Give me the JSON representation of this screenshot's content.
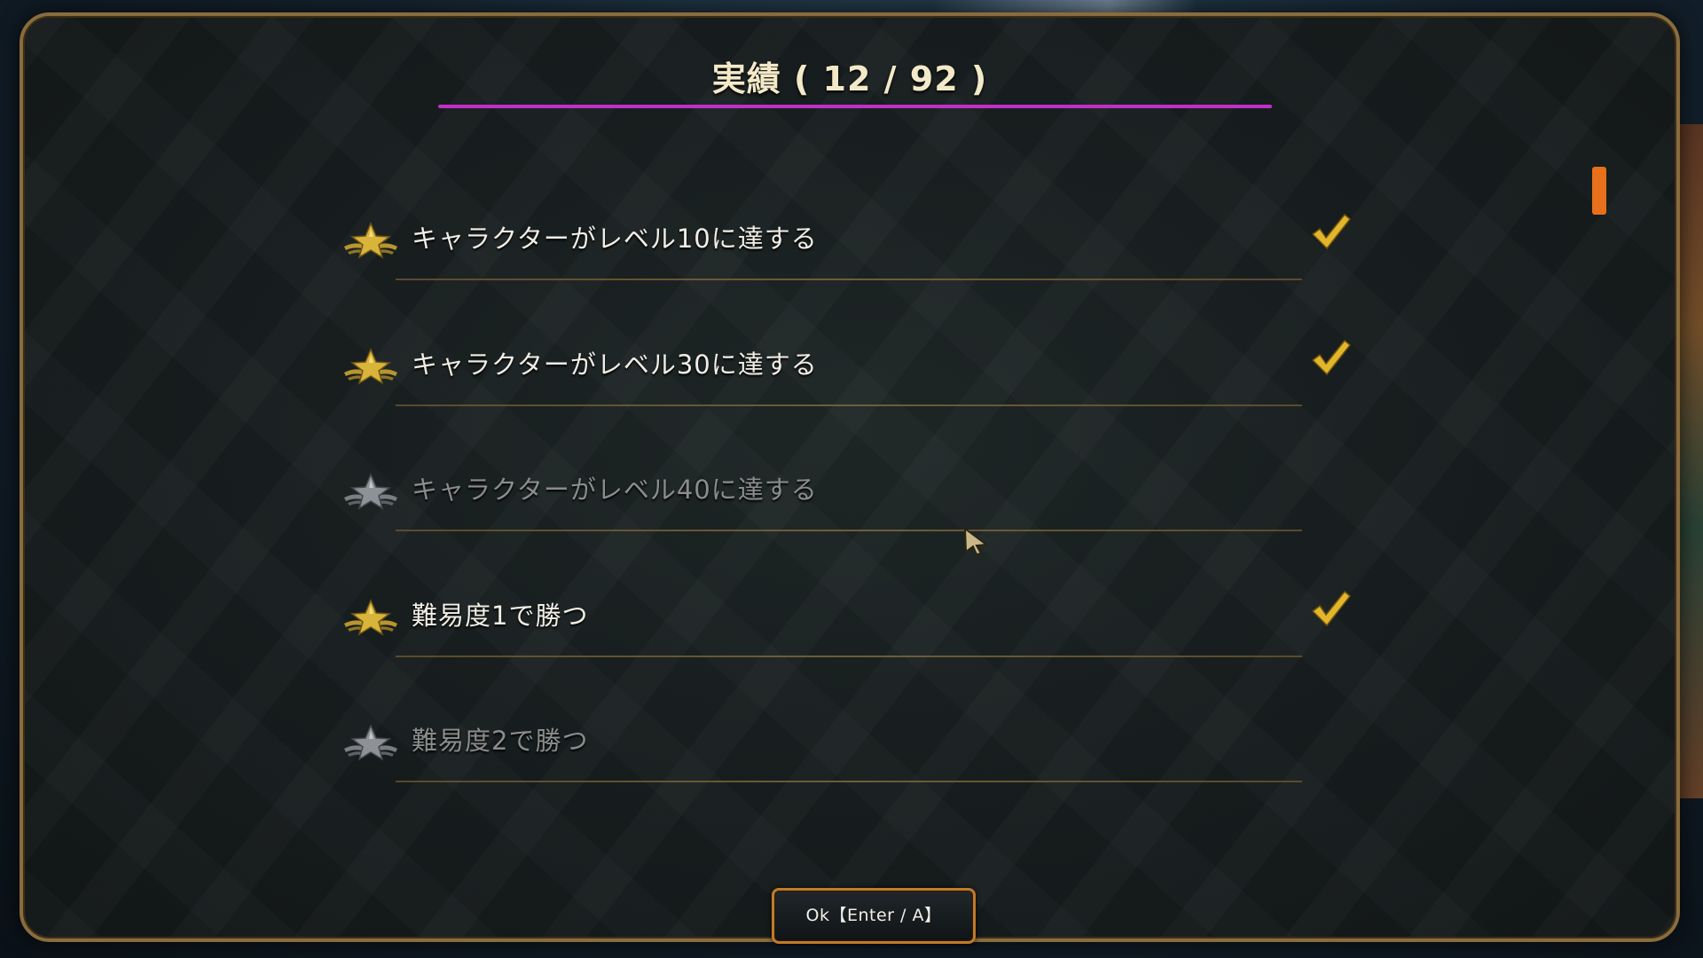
{
  "dialog": {
    "title": "実績 ( 12 / 92 )"
  },
  "achievements": [
    {
      "label": "キャラクターがレベル10に達する",
      "completed": true
    },
    {
      "label": "キャラクターがレベル30に達する",
      "completed": true
    },
    {
      "label": "キャラクターがレベル40に達する",
      "completed": false
    },
    {
      "label": "難易度1で勝つ",
      "completed": true
    },
    {
      "label": "難易度2で勝つ",
      "completed": false
    }
  ],
  "ok_button": {
    "label": "Ok【Enter / A】"
  },
  "colors": {
    "title_underline": "#c02fc9",
    "scroll_thumb": "#e8701a",
    "completed_star": "#d9b43a",
    "locked_star": "#8e9196",
    "checkmark": "#e2b52a",
    "button_border": "#c27a28",
    "panel_border": "#8a6c3d"
  },
  "icons": {
    "completed": "gold-winged-star-icon",
    "locked": "silver-winged-star-icon",
    "done": "checkmark-icon"
  }
}
